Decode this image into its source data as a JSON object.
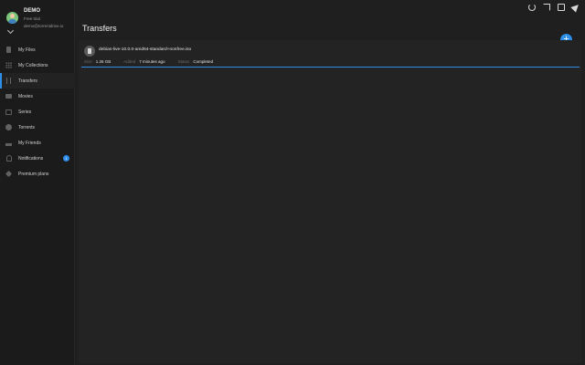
{
  "profile": {
    "name": "DEMO",
    "plan": "Free trial",
    "email": "demo@torrentdrive.io"
  },
  "sidebar": {
    "items": [
      {
        "label": "My Files"
      },
      {
        "label": "My Collections"
      },
      {
        "label": "Transfers"
      },
      {
        "label": "Movies"
      },
      {
        "label": "Series"
      },
      {
        "label": "Torrents"
      },
      {
        "label": "My Friends"
      },
      {
        "label": "Notifications",
        "badge": "1"
      },
      {
        "label": "Premium plans"
      }
    ],
    "active": "Transfers"
  },
  "main": {
    "title": "Transfers",
    "add_label": "+",
    "transfers": [
      {
        "filename": "debian-live-10.0.0-amd64-standard+nonfree.iso",
        "size_label": "Size",
        "size": "1.26 GB",
        "added_label": "Added",
        "added": "7 minutes ago",
        "status_label": "Status",
        "status": "Completed"
      }
    ]
  },
  "colors": {
    "accent": "#2f8dea",
    "background": "#1f1f1f",
    "sidebar": "#1b1b1b",
    "panel": "#232323"
  },
  "icons": {
    "top_bar": [
      "refresh-icon",
      "cast-icon",
      "fullscreen-icon",
      "send-icon"
    ]
  }
}
